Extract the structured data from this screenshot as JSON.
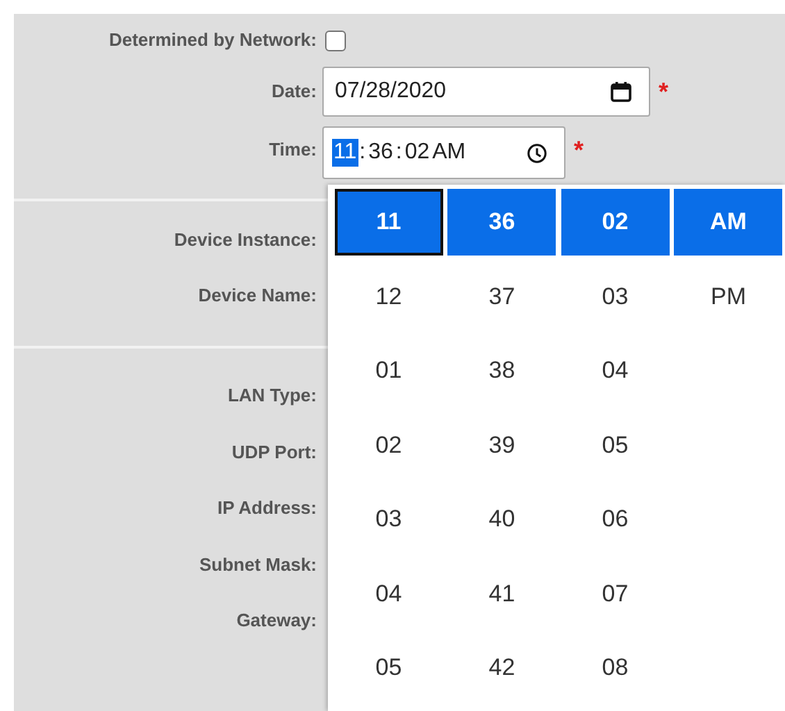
{
  "network": {
    "label": "Determined by Network:",
    "checked": false
  },
  "date": {
    "label": "Date:",
    "value": "07/28/2020",
    "required_mark": "*"
  },
  "time": {
    "label": "Time:",
    "required_mark": "*",
    "segments": [
      {
        "text": "11",
        "selected": true,
        "suffix": ":"
      },
      {
        "text": "36",
        "selected": false,
        "suffix": ":"
      },
      {
        "text": "02",
        "selected": false
      },
      {
        "text": "AM",
        "selected": false
      }
    ]
  },
  "device_labels": [
    "Device Instance:",
    "Device Name:"
  ],
  "network_labels": [
    "LAN Type:",
    "UDP Port:",
    "IP Address:",
    "Subnet Mask:",
    "Gateway:"
  ],
  "picker": {
    "columns": [
      {
        "focused": true,
        "items": [
          {
            "text": "11",
            "selected": true
          },
          {
            "text": "12",
            "selected": false
          },
          {
            "text": "01",
            "selected": false
          },
          {
            "text": "02",
            "selected": false
          },
          {
            "text": "03",
            "selected": false
          },
          {
            "text": "04",
            "selected": false
          },
          {
            "text": "05",
            "selected": false
          }
        ]
      },
      {
        "focused": false,
        "items": [
          {
            "text": "36",
            "selected": true
          },
          {
            "text": "37",
            "selected": false
          },
          {
            "text": "38",
            "selected": false
          },
          {
            "text": "39",
            "selected": false
          },
          {
            "text": "40",
            "selected": false
          },
          {
            "text": "41",
            "selected": false
          },
          {
            "text": "42",
            "selected": false
          }
        ]
      },
      {
        "focused": false,
        "items": [
          {
            "text": "02",
            "selected": true
          },
          {
            "text": "03",
            "selected": false
          },
          {
            "text": "04",
            "selected": false
          },
          {
            "text": "05",
            "selected": false
          },
          {
            "text": "06",
            "selected": false
          },
          {
            "text": "07",
            "selected": false
          },
          {
            "text": "08",
            "selected": false
          }
        ]
      },
      {
        "focused": false,
        "items": [
          {
            "text": "AM",
            "selected": true
          },
          {
            "text": "PM",
            "selected": false
          }
        ]
      }
    ]
  }
}
